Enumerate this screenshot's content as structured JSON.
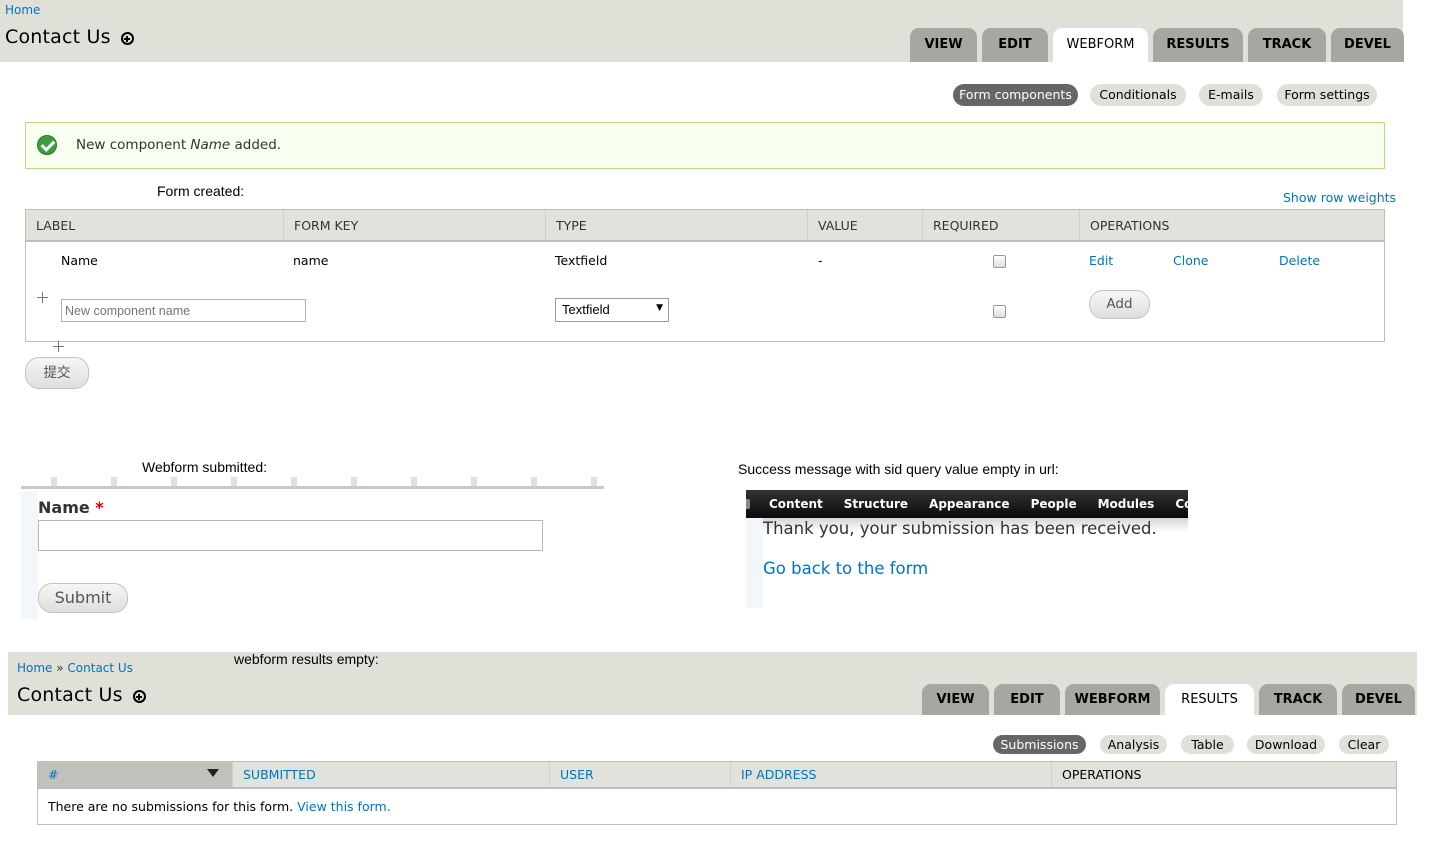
{
  "top": {
    "breadcrumb": "Home",
    "title": "Contact Us",
    "tabs": [
      "VIEW",
      "EDIT",
      "WEBFORM",
      "RESULTS",
      "TRACK",
      "DEVEL"
    ],
    "active_tab": "WEBFORM",
    "subtabs": [
      "Form components",
      "Conditionals",
      "E-mails",
      "Form settings"
    ],
    "active_subtab": "Form components"
  },
  "status": {
    "prefix": "New component ",
    "name": "Name",
    "suffix": " added."
  },
  "form_created_caption": "Form created:",
  "show_row_weights": "Show row weights",
  "components_table": {
    "headers": [
      "LABEL",
      "FORM KEY",
      "TYPE",
      "VALUE",
      "REQUIRED",
      "OPERATIONS"
    ],
    "row": {
      "label": "Name",
      "form_key": "name",
      "type": "Textfield",
      "value": "-",
      "ops": [
        "Edit",
        "Clone",
        "Delete"
      ]
    },
    "new_row": {
      "placeholder": "New component name",
      "type_selected": "Textfield",
      "add_label": "Add"
    }
  },
  "submit_cn": "提交",
  "webform_submitted_caption": "Webform submitted:",
  "submitted_form": {
    "name_label": "Name",
    "required_mark": "*",
    "submit_label": "Submit"
  },
  "success_caption": "Success message with sid query value empty in url:",
  "success_shot": {
    "admin_menu": [
      "Content",
      "Structure",
      "Appearance",
      "People",
      "Modules",
      "Configuratio"
    ],
    "message": "Thank you, your submission has been received.",
    "back_link": "Go back to the form"
  },
  "results_caption": "webform results empty:",
  "bottom": {
    "breadcrumb_home": "Home",
    "breadcrumb_sep": " » ",
    "breadcrumb_page": "Contact Us",
    "title": "Contact Us",
    "tabs": [
      "VIEW",
      "EDIT",
      "WEBFORM",
      "RESULTS",
      "TRACK",
      "DEVEL"
    ],
    "active_tab": "RESULTS",
    "subtabs": [
      "Submissions",
      "Analysis",
      "Table",
      "Download",
      "Clear"
    ],
    "active_subtab": "Submissions",
    "headers": [
      "#",
      "SUBMITTED",
      "USER",
      "IP ADDRESS",
      "OPERATIONS"
    ],
    "empty_text": "There are no submissions for this form. ",
    "empty_link": "View this form."
  },
  "colors": {
    "link": "#0074bd",
    "header_bg": "#e0e0d8",
    "tab_bg": "#a6a7a2",
    "status_border": "#b3e07b",
    "status_ok": "#3e9d3e",
    "active_subtab": "#666666"
  }
}
